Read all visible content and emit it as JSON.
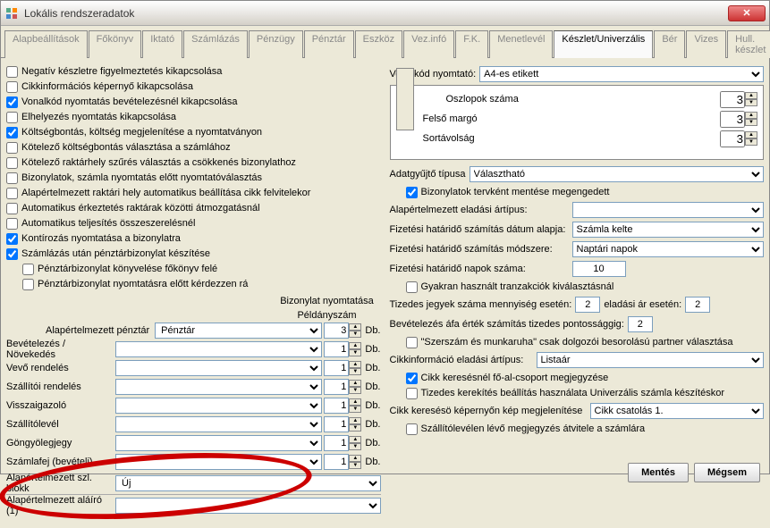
{
  "window": {
    "title": "Lokális rendszeradatok"
  },
  "tabs": [
    "Alapbeállítások",
    "Főkönyv",
    "Iktató",
    "Számlázás",
    "Pénzügy",
    "Pénztár",
    "Eszköz",
    "Vez.infó",
    "F.K.",
    "Menetlevél",
    "Készlet/Univerzális",
    "Bér",
    "Vizes",
    "Hull. készlet"
  ],
  "active_tab": 10,
  "left": {
    "checks": [
      {
        "checked": false,
        "label": "Negatív készletre figyelmeztetés kikapcsolása"
      },
      {
        "checked": false,
        "label": "Cikkinformációs képernyő kikapcsolása"
      },
      {
        "checked": true,
        "label": "Vonalkód nyomtatás bevételezésnél kikapcsolása"
      },
      {
        "checked": false,
        "label": "Elhelyezés nyomtatás kikapcsolása"
      },
      {
        "checked": true,
        "label": "Költségbontás, költség megjelenítése a nyomtatványon"
      },
      {
        "checked": false,
        "label": "Kötelező költségbontás választása a számlához"
      },
      {
        "checked": false,
        "label": "Kötelező raktárhely szűrés választás a csökkenés bizonylathoz"
      },
      {
        "checked": false,
        "label": "Bizonylatok, számla nyomtatás előtt nyomtatóválasztás"
      },
      {
        "checked": false,
        "label": "Alapértelmezett raktári hely automatikus beállítása cikk felvitelekor"
      },
      {
        "checked": false,
        "label": "Automatikus érkeztetés raktárak közötti átmozgatásnál"
      },
      {
        "checked": false,
        "label": "Automatikus teljesítés összeszerelésnél"
      },
      {
        "checked": true,
        "label": "Kontírozás nyomtatása a bizonylatra"
      },
      {
        "checked": true,
        "label": "Számlázás után pénztárbizonylat készítése"
      },
      {
        "checked": false,
        "label": "Pénztárbizonylat könyvelése főkönyv felé",
        "indent": 1
      },
      {
        "checked": false,
        "label": "Pénztárbizonylat nyomtatásra előtt kérdezzen rá",
        "indent": 1
      }
    ],
    "bizonylat_hdr": "Bizonylat nyomtatása",
    "peldany_hdr": "Példányszám",
    "default_penztar_lbl": "Alapértelmezett pénztár",
    "default_penztar_val": "Pénztár",
    "default_penztar_count": "3",
    "rows": [
      {
        "label": "Bevételezés / Növekedés",
        "count": "1"
      },
      {
        "label": "Vevő rendelés",
        "count": "1"
      },
      {
        "label": "Szállítói rendelés",
        "count": "1"
      },
      {
        "label": "Visszaigazoló",
        "count": "1"
      },
      {
        "label": "Szállítólevél",
        "count": "1"
      },
      {
        "label": "Göngyölegjegy",
        "count": "1"
      },
      {
        "label": "Számlafej (bevételi)",
        "count": "1"
      }
    ],
    "db": "Db.",
    "blokk_lbl": "Alapértelmezett szl. blokk",
    "blokk_val": "Új",
    "aliro_lbl": "Alapértelmezett aláíró (1)"
  },
  "right": {
    "barcode_printer_lbl": "Vonalkód nyomtató:",
    "barcode_printer_val": "A4-es etikett",
    "barcode_cols": {
      "oszlop": "Oszlopok száma",
      "felso": "Felső margó",
      "sor": "Sortávolság"
    },
    "barcode_cols_val": {
      "oszlop": "3",
      "felso": "3",
      "sor": "3"
    },
    "adatgyujto_lbl": "Adatgyűjtő típusa",
    "adatgyujto_val": "Választható",
    "biz_tervkent": "Bizonylatok tervként mentése megengedett",
    "eladasi_artipus_lbl": "Alapértelmezett eladási ártípus:",
    "fiz_alapja_lbl": "Fizetési határidő számítás dátum alapja:",
    "fiz_alapja_val": "Számla kelte",
    "fiz_modszer_lbl": "Fizetési határidő számítás módszere:",
    "fiz_modszer_val": "Naptári napok",
    "fiz_napok_lbl": "Fizetési határidő napok száma:",
    "fiz_napok_val": "10",
    "gyakran_lbl": "Gyakran használt tranzakciók kiválasztásnál",
    "tizedes_menny_lbl": "Tizedes jegyek száma mennyiség esetén:",
    "tizedes_menny_val": "2",
    "tizedes_ar_lbl": "eladási ár esetén:",
    "tizedes_ar_val": "2",
    "bevet_lbl": "Bevételezés áfa érték számítás tizedes pontossággig:",
    "bevet_val": "2",
    "szerszam_lbl": "\"Szerszám és munkaruha\" csak dolgozói besorolású partner választása",
    "cikkinfo_lbl": "Cikkinformáció eladási ártípus:",
    "cikkinfo_val": "Listaár",
    "cikk_kereses_lbl": "Cikk keresésnél fő-al-csoport megjegyzése",
    "tizedes_kerekit_lbl": "Tizedes kerekítés beállítás használata Univerzális számla készítéskor",
    "cikk_kep_lbl": "Cikk keresésö képernyőn kép megjelenítése",
    "cikk_kep_val": "Cikk csatolás 1.",
    "szallito_lbl": "Szállítólevélen lévő megjegyzés átvitele a számlára"
  },
  "buttons": {
    "save": "Mentés",
    "cancel": "Mégsem"
  }
}
